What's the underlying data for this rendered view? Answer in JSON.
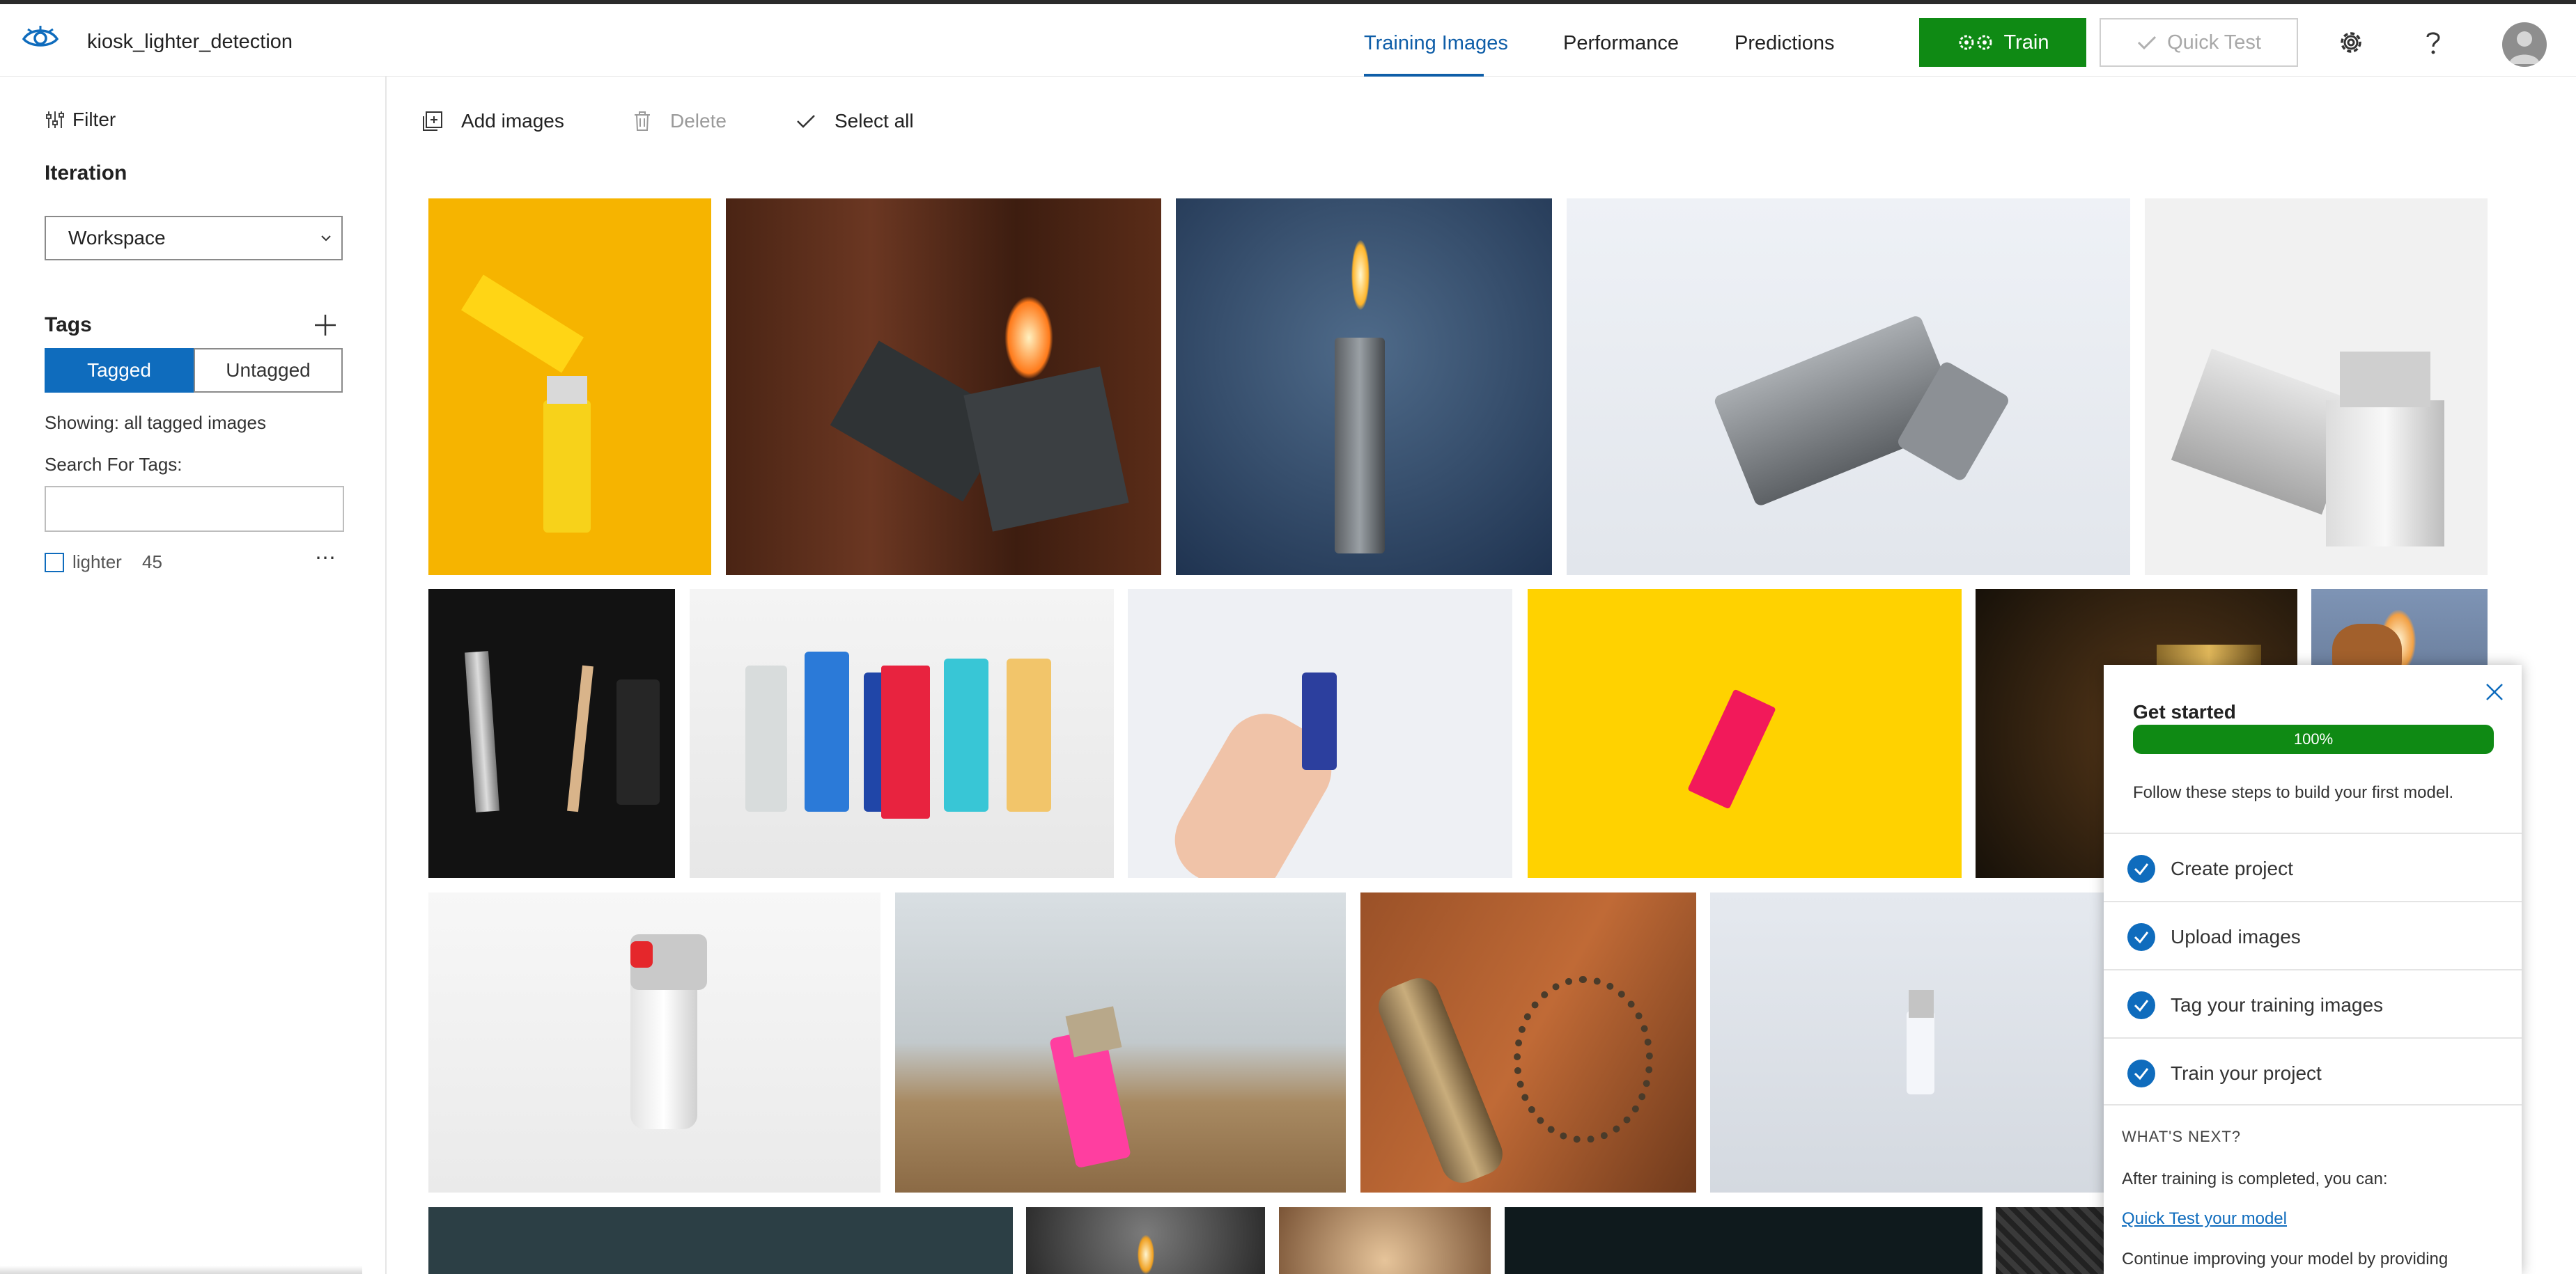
{
  "app": {
    "project_name": "kiosk_lighter_detection",
    "logo_icon": "eye-icon"
  },
  "nav": {
    "tabs": [
      {
        "label": "Training Images",
        "active": true
      },
      {
        "label": "Performance",
        "active": false
      },
      {
        "label": "Predictions",
        "active": false
      }
    ]
  },
  "header_actions": {
    "train_label": "Train",
    "quick_test_label": "Quick Test",
    "settings_icon": "gear-icon",
    "help_icon": "question-icon",
    "avatar_icon": "user-avatar-icon"
  },
  "sidebar": {
    "filter_label": "Filter",
    "iteration_heading": "Iteration",
    "iteration_value": "Workspace",
    "tags_heading": "Tags",
    "tagged_label": "Tagged",
    "untagged_label": "Untagged",
    "showing_text": "Showing: all tagged images",
    "search_label": "Search For Tags:",
    "search_value": "",
    "tags": [
      {
        "name": "lighter",
        "count": "45",
        "checked": false
      }
    ]
  },
  "toolbar": {
    "add_images_label": "Add images",
    "delete_label": "Delete",
    "select_all_label": "Select all"
  },
  "get_started": {
    "title": "Get started",
    "progress": 100,
    "progress_label": "100%",
    "description": "Follow these steps to build your first model.",
    "steps": [
      {
        "label": "Create project",
        "done": true
      },
      {
        "label": "Upload images",
        "done": true
      },
      {
        "label": "Tag your training images",
        "done": true
      },
      {
        "label": "Train your project",
        "done": true
      }
    ],
    "whats_next": "WHAT'S NEXT?",
    "after_training": "After training is completed, you can:",
    "quick_test_link": "Quick Test your model",
    "continue_text": "Continue improving your model by providing"
  },
  "colors": {
    "accent_blue": "#0f6cbd",
    "train_green": "#0f8a14"
  }
}
